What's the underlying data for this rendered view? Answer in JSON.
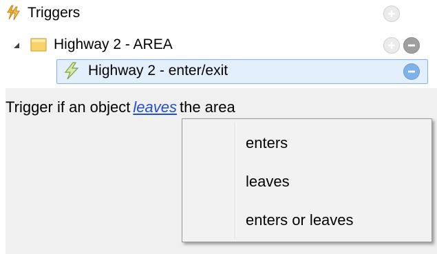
{
  "tree": {
    "root": {
      "label": "Triggers",
      "icon": "triggers-icon"
    },
    "area": {
      "label": "Highway 2  - AREA",
      "icon": "folder-icon",
      "expander": "collapse-triangle-icon"
    },
    "trigger": {
      "label": "Highway 2  - enter/exit",
      "icon": "lightning-bolt-icon"
    }
  },
  "condition": {
    "prefix": "Trigger if an object",
    "selected_value": "leaves",
    "suffix": "the area"
  },
  "dropdown": {
    "options": [
      "enters",
      "leaves",
      "enters or leaves"
    ]
  },
  "colors": {
    "selection_bg": "#e3effc",
    "selection_border": "#7eb4ea",
    "link": "#1f4fd6",
    "panel_bg": "#f0f0f0"
  }
}
